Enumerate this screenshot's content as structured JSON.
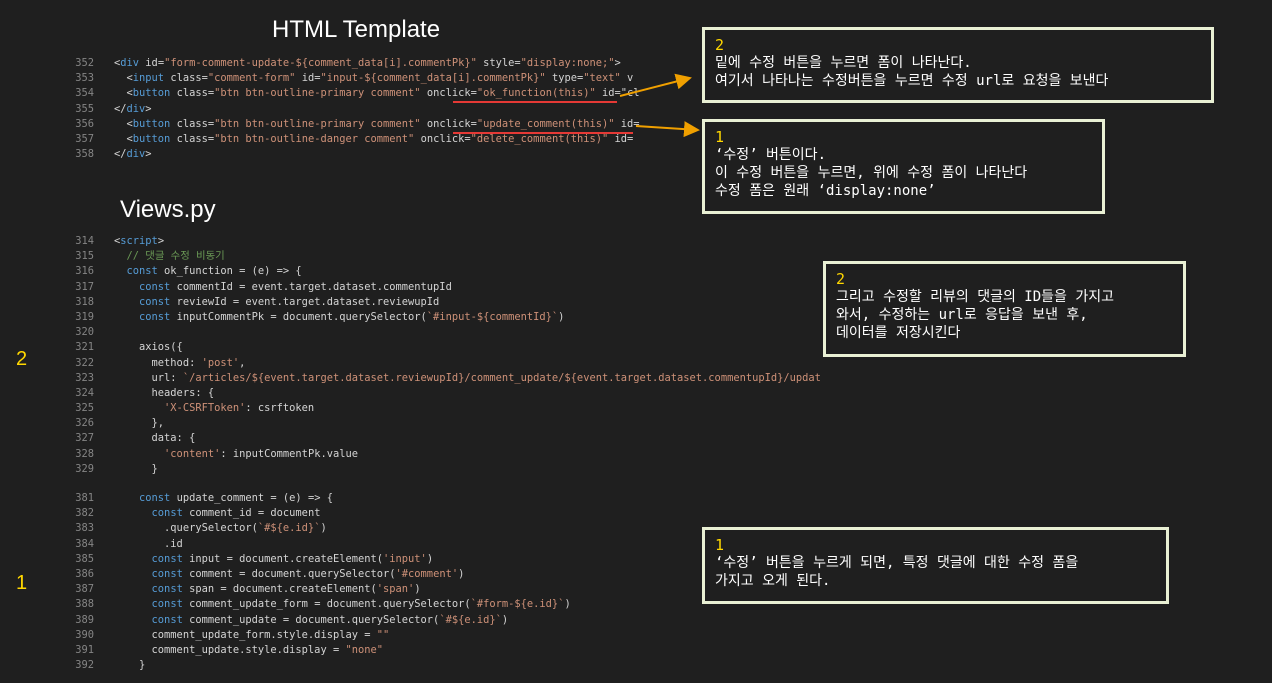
{
  "titles": {
    "html_template": "HTML Template",
    "views_py": "Views.py"
  },
  "side_numbers": {
    "upper": "2",
    "lower": "1"
  },
  "notes": [
    {
      "num": "2",
      "lines": [
        "밑에 수정 버튼을 누르면 폼이 나타난다.",
        "여기서 나타나는 수정버튼을 누르면 수정 url로 요청을 보낸다"
      ]
    },
    {
      "num": "1",
      "lines": [
        "‘수정’ 버튼이다.",
        "이 수정 버튼을 누르면, 위에 수정 폼이 나타난다",
        "수정 폼은 원래 ‘display:none’"
      ]
    },
    {
      "num": "2",
      "lines": [
        "그리고 수정할 리뷰의 댓글의 ID들을 가지고",
        "와서, 수정하는 url로 응답을 보낸 후,",
        "데이터를 저장시킨다"
      ]
    },
    {
      "num": "1",
      "lines": [
        "‘수정’ 버튼을 누르게 되면, 특정 댓글에 대한 수정 폼을",
        "가지고 오게 된다."
      ]
    }
  ],
  "html_code": [
    {
      "ln": "352",
      "text": "<div id=\"form-comment-update-${comment_data[i].commentPk}\" style=\"display:none;\">"
    },
    {
      "ln": "353",
      "text": "  <input class=\"comment-form\" id=\"input-${comment_data[i].commentPk}\" type=\"text\" v"
    },
    {
      "ln": "354",
      "text": "  <button class=\"btn btn-outline-primary comment\" onclick=\"ok_function(this)\" id=\"cl"
    },
    {
      "ln": "355",
      "text": "</div>"
    },
    {
      "ln": "356",
      "text": "  <button class=\"btn btn-outline-primary comment\" onclick=\"update_comment(this)\" id="
    },
    {
      "ln": "357",
      "text": "  <button class=\"btn btn-outline-danger comment\" onclick=\"delete_comment(this)\" id="
    },
    {
      "ln": "358",
      "text": "</div>"
    }
  ],
  "views_code_1": [
    {
      "ln": "314",
      "text": "<script>"
    },
    {
      "ln": "315",
      "text": "  // 댓글 수정 비동기"
    },
    {
      "ln": "316",
      "text": "  const ok_function = (e) => {"
    },
    {
      "ln": "317",
      "text": "    const commentId = event.target.dataset.commentupId"
    },
    {
      "ln": "318",
      "text": "    const reviewId = event.target.dataset.reviewupId"
    },
    {
      "ln": "319",
      "text": "    const inputCommentPk = document.querySelector(`#input-${commentId}`)"
    },
    {
      "ln": "320",
      "text": ""
    },
    {
      "ln": "321",
      "text": "    axios({"
    },
    {
      "ln": "322",
      "text": "      method: 'post',"
    },
    {
      "ln": "323",
      "text": "      url: `/articles/${event.target.dataset.reviewupId}/comment_update/${event.target.dataset.commentupId}/update`,"
    },
    {
      "ln": "324",
      "text": "      headers: {"
    },
    {
      "ln": "325",
      "text": "        'X-CSRFToken': csrftoken"
    },
    {
      "ln": "326",
      "text": "      },"
    },
    {
      "ln": "327",
      "text": "      data: {"
    },
    {
      "ln": "328",
      "text": "        'content': inputCommentPk.value"
    },
    {
      "ln": "329",
      "text": "      }"
    }
  ],
  "views_code_2": [
    {
      "ln": "381",
      "text": "    const update_comment = (e) => {"
    },
    {
      "ln": "382",
      "text": "      const comment_id = document"
    },
    {
      "ln": "383",
      "text": "        .querySelector(`#${e.id}`)"
    },
    {
      "ln": "384",
      "text": "        .id"
    },
    {
      "ln": "385",
      "text": "      const input = document.createElement('input')"
    },
    {
      "ln": "386",
      "text": "      const comment = document.querySelector('#comment')"
    },
    {
      "ln": "387",
      "text": "      const span = document.createElement('span')"
    },
    {
      "ln": "388",
      "text": "      const comment_update_form = document.querySelector(`#form-${e.id}`)"
    },
    {
      "ln": "389",
      "text": "      const comment_update = document.querySelector(`#${e.id}`)"
    },
    {
      "ln": "390",
      "text": "      comment_update_form.style.display = \"\""
    },
    {
      "ln": "391",
      "text": "      comment_update.style.display = \"none\""
    },
    {
      "ln": "392",
      "text": "    }"
    }
  ]
}
